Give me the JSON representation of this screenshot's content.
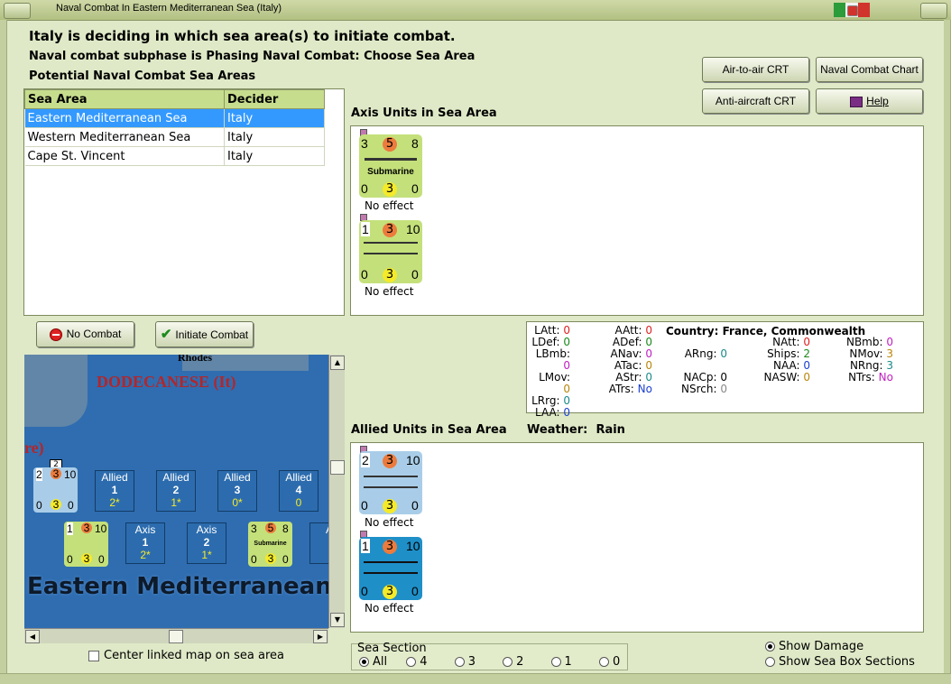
{
  "window": {
    "title": "Naval Combat In Eastern Mediterranean Sea (Italy)"
  },
  "header": {
    "line1": "Italy is deciding in which sea area(s) to initiate combat.",
    "line2": "Naval combat subphase is Phasing Naval Combat: Choose Sea Area",
    "line3": "Potential Naval Combat Sea Areas"
  },
  "buttons": {
    "air_crt": "Air-to-air CRT",
    "naval_chart": "Naval Combat Chart",
    "aa_crt": "Anti-aircraft CRT",
    "help": "Help",
    "no_combat": "No Combat",
    "initiate": "Initiate Combat"
  },
  "sea_table": {
    "headers": [
      "Sea Area",
      "Decider"
    ],
    "rows": [
      {
        "area": "Eastern Mediterranean Sea",
        "decider": "Italy"
      },
      {
        "area": "Western Mediterranean Sea",
        "decider": "Italy"
      },
      {
        "area": "Cape St. Vincent",
        "decider": "Italy"
      }
    ]
  },
  "axis_section": {
    "label": "Axis Units in Sea Area",
    "units": [
      {
        "tl": "3",
        "tc": "5",
        "tr": "8",
        "name": "Submarine",
        "bl": "0",
        "bc": "3",
        "br": "0",
        "effect": "No effect"
      },
      {
        "tl": "1",
        "tc": "3",
        "tr": "10",
        "name": "",
        "bl": "0",
        "bc": "3",
        "br": "0",
        "effect": "No effect"
      }
    ]
  },
  "allied_section": {
    "label": "Allied Units in Sea Area",
    "weather_label": "Weather:",
    "weather_value": "Rain",
    "units": [
      {
        "tl": "2",
        "tc": "3",
        "tr": "10",
        "bl": "0",
        "bc": "3",
        "br": "0",
        "effect": "No effect"
      },
      {
        "tl": "1",
        "tc": "3",
        "tr": "10",
        "bl": "0",
        "bc": "3",
        "br": "0",
        "effect": "No effect"
      }
    ]
  },
  "stats": {
    "country_label": "Country:",
    "country_value": "France, Commonwealth",
    "col1": [
      {
        "k": "LAtt:",
        "v": "0"
      },
      {
        "k": "LDef:",
        "v": "0"
      },
      {
        "k": "LBmb:",
        "v": "0"
      },
      {
        "k": "LMov:",
        "v": "0"
      },
      {
        "k": "LRrg:",
        "v": "0"
      },
      {
        "k": "LAA:",
        "v": "0"
      }
    ],
    "col2": [
      {
        "k": "AAtt:",
        "v": "0"
      },
      {
        "k": "ADef:",
        "v": "0"
      },
      {
        "k": "ANav:",
        "v": "0"
      },
      {
        "k": "ATac:",
        "v": "0"
      },
      {
        "k": "AStr:",
        "v": "0"
      },
      {
        "k": "ATrs:",
        "v": "No"
      }
    ],
    "col3": [
      {
        "k": "ARng:",
        "v": "0"
      },
      {
        "k": "NACp:",
        "v": "0"
      },
      {
        "k": "NSrch:",
        "v": "0"
      }
    ],
    "col4": [
      {
        "k": "NAtt:",
        "v": "0"
      },
      {
        "k": "Ships:",
        "v": "2"
      },
      {
        "k": "NAA:",
        "v": "0"
      },
      {
        "k": "NASW:",
        "v": "0"
      }
    ],
    "col5": [
      {
        "k": "NBmb:",
        "v": "0"
      },
      {
        "k": "NMov:",
        "v": "3"
      },
      {
        "k": "NRng:",
        "v": "3"
      },
      {
        "k": "NTrs:",
        "v": "No"
      }
    ]
  },
  "map": {
    "label_rhodes": "Rhodes",
    "label_dodecanese": "DODECANESE (It)",
    "label_re": "re)",
    "label_sea": "Eastern Mediterranean",
    "stack_count": "2",
    "allied_boxes": [
      {
        "title": "Allied",
        "num": "1",
        "val": "2*"
      },
      {
        "title": "Allied",
        "num": "2",
        "val": "1*"
      },
      {
        "title": "Allied",
        "num": "3",
        "val": "0*"
      },
      {
        "title": "Allied",
        "num": "4",
        "val": "0"
      }
    ],
    "axis_boxes": [
      {
        "title": "Axis",
        "num": "1",
        "val": "2*"
      },
      {
        "title": "Axis",
        "num": "2",
        "val": "1*"
      },
      {
        "title": "A",
        "num": "",
        "val": ""
      }
    ],
    "map_counter_allied": {
      "tl": "2",
      "tc": "3",
      "tr": "10",
      "bl": "0",
      "bc": "3",
      "br": "0"
    },
    "map_counter_axis1": {
      "tl": "1",
      "tc": "3",
      "tr": "10",
      "bl": "0",
      "bc": "3",
      "br": "0"
    },
    "map_counter_axis2": {
      "tl": "3",
      "tc": "5",
      "tr": "8",
      "name": "Submarine",
      "bl": "0",
      "bc": "3",
      "br": "0"
    }
  },
  "center_map": "Center linked map on sea area",
  "sea_section": {
    "label": "Sea Section",
    "options": [
      "All",
      "4",
      "3",
      "2",
      "1",
      "0"
    ],
    "selected": "All"
  },
  "display_opts": {
    "show_damage": "Show Damage",
    "show_sections": "Show Sea Box Sections"
  },
  "colors": {
    "accent_green": "#c7dd8e",
    "selection_blue": "#3399ff",
    "sea_blue": "#2f6db0"
  }
}
